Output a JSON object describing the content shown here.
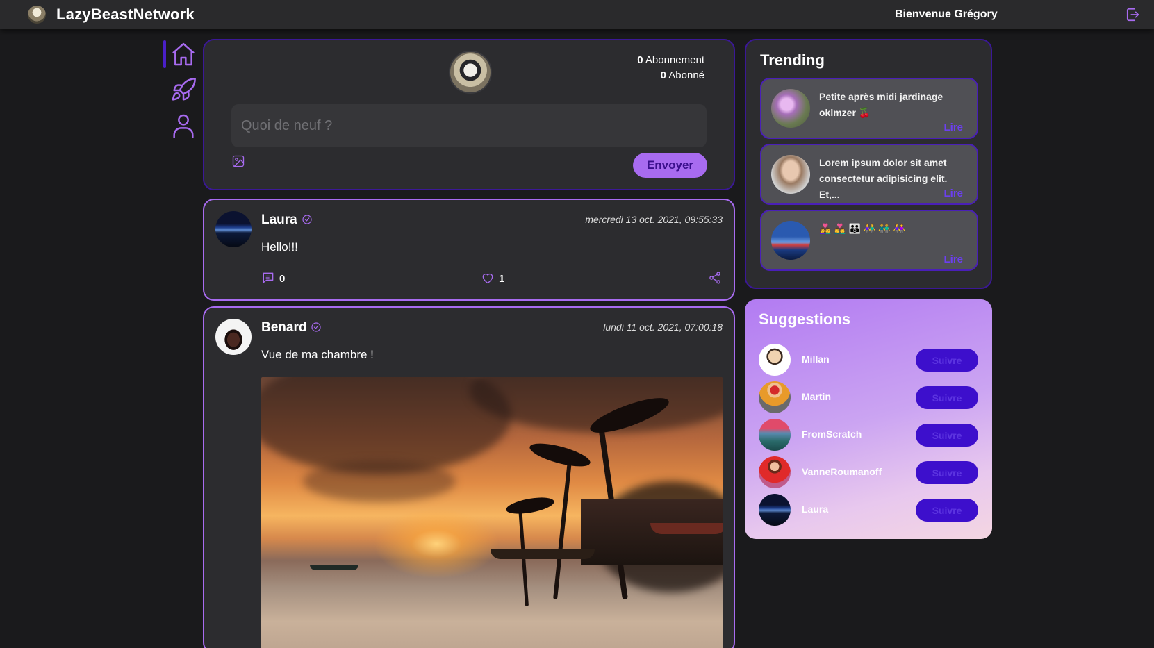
{
  "app": {
    "brand": "LazyBeastNetwork",
    "welcome": "Bienvenue Grégory"
  },
  "icons": {
    "logo": "beast-logo-icon",
    "logout": "logout-icon",
    "nav": [
      "home-icon",
      "rocket-icon",
      "user-icon"
    ],
    "image": "image-icon",
    "verified": "verified-icon",
    "comment": "comment-icon",
    "like": "heart-icon",
    "share": "share-icon"
  },
  "colors": {
    "accent": "#a86bf0",
    "deep_purple": "#3d0fcc",
    "border": "#3b1896",
    "background": "#1a1a1c",
    "panel": "#2c2c2f"
  },
  "composer": {
    "following": "0",
    "following_label": "Abonnement",
    "followers": "0",
    "followers_label": "Abonné",
    "placeholder": "Quoi de neuf ?",
    "send_label": "Envoyer"
  },
  "posts": [
    {
      "author": "Laura",
      "date": "mercredi 13 oct. 2021, 09:55:33",
      "text": "Hello!!!",
      "comments": "0",
      "likes": "1"
    },
    {
      "author": "Benard",
      "date": "lundi 11 oct. 2021, 07:00:18",
      "text": "Vue de ma chambre !"
    }
  ],
  "trending": {
    "title": "Trending",
    "items": [
      {
        "text": "Petite après midi jardinage oklmzer 🍒",
        "read": "Lire"
      },
      {
        "text": "Lorem ipsum dolor sit amet consectetur adipisicing elit. Et,...",
        "read": "Lire"
      },
      {
        "text": "👩‍❤️‍👨 👨‍❤️‍👨 👪 👫 👬 👭",
        "read": "Lire"
      }
    ]
  },
  "suggestions": {
    "title": "Suggestions",
    "follow_label": "Suivre",
    "users": [
      {
        "name": "Millan"
      },
      {
        "name": "Martin"
      },
      {
        "name": "FromScratch"
      },
      {
        "name": "VanneRoumanoff"
      },
      {
        "name": "Laura"
      }
    ]
  }
}
